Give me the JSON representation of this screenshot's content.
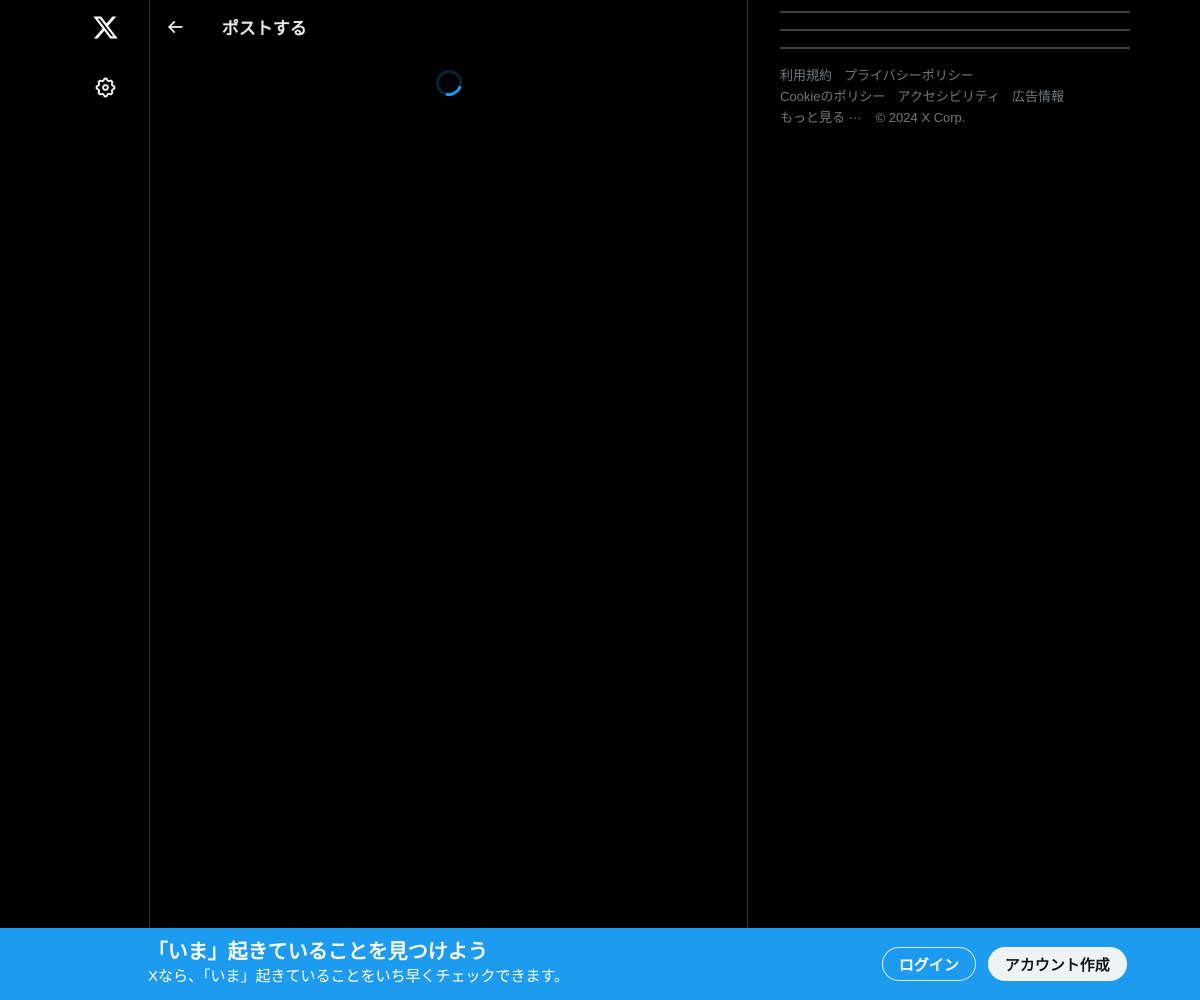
{
  "colors": {
    "background": "#000000",
    "border": "#2f3336",
    "accent_blue": "#1d9bf0",
    "text_primary": "#e7e9ea",
    "text_secondary": "#71767b",
    "banner_background": "#1d9bf0",
    "signup_button_background": "#eff3f4",
    "signup_button_text": "#0f1419"
  },
  "left_rail": {
    "logo_icon": "x-logo-icon",
    "settings_icon": "gear-icon"
  },
  "header": {
    "back_icon": "back-arrow-icon",
    "title": "ポストする"
  },
  "main": {
    "state": "loading",
    "spinner_icon": "loading-spinner"
  },
  "right_sidebar": {
    "skeleton_line_count": 3,
    "footer": {
      "links": [
        "利用規約",
        "プライバシーポリシー",
        "Cookieのポリシー",
        "アクセシビリティ",
        "広告情報",
        "もっと見る ···"
      ],
      "copyright": "© 2024 X Corp."
    }
  },
  "banner": {
    "heading": "「いま」起きていることを見つけよう",
    "subtitle": "Xなら、「いま」起きていることをいち早くチェックできます。",
    "login_label": "ログイン",
    "signup_label": "アカウント作成"
  }
}
